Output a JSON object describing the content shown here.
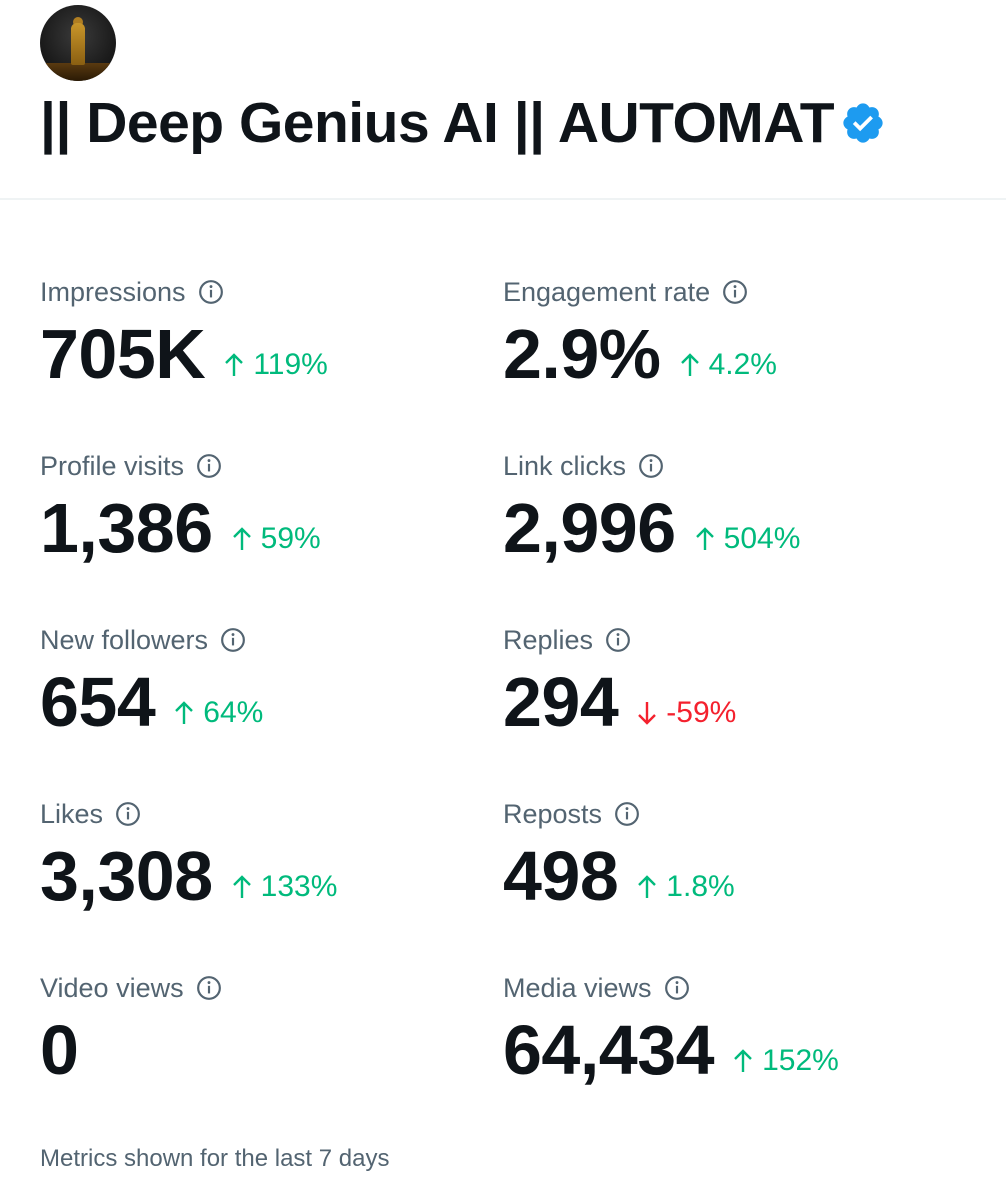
{
  "profile": {
    "name": "|| Deep Genius AI || AUTOMAT",
    "verified": true,
    "verified_color": "#1d9bf0"
  },
  "metrics": [
    {
      "label": "Impressions",
      "value": "705K",
      "change": "119%",
      "direction": "up"
    },
    {
      "label": "Engagement rate",
      "value": "2.9%",
      "change": "4.2%",
      "direction": "up"
    },
    {
      "label": "Profile visits",
      "value": "1,386",
      "change": "59%",
      "direction": "up"
    },
    {
      "label": "Link clicks",
      "value": "2,996",
      "change": "504%",
      "direction": "up"
    },
    {
      "label": "New followers",
      "value": "654",
      "change": "64%",
      "direction": "up"
    },
    {
      "label": "Replies",
      "value": "294",
      "change": "-59%",
      "direction": "down"
    },
    {
      "label": "Likes",
      "value": "3,308",
      "change": "133%",
      "direction": "up"
    },
    {
      "label": "Reposts",
      "value": "498",
      "change": "1.8%",
      "direction": "up"
    },
    {
      "label": "Video views",
      "value": "0",
      "change": "",
      "direction": "none"
    },
    {
      "label": "Media views",
      "value": "64,434",
      "change": "152%",
      "direction": "up"
    }
  ],
  "colors": {
    "up": "#00ba7c",
    "down": "#f4212e",
    "label": "#536471",
    "text": "#0f1419"
  },
  "footer": "Metrics shown for the last 7 days"
}
